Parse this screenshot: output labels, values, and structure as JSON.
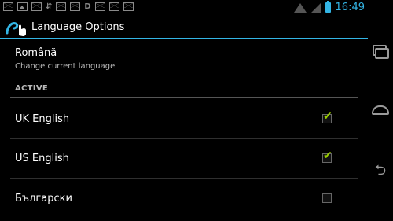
{
  "statusbar": {
    "time": "16:49",
    "notification_icons": [
      "mail-icon",
      "image-icon",
      "mail-icon",
      "sync-icon",
      "mail-icon",
      "mail-icon",
      "d-icon",
      "mail-icon",
      "mail-icon",
      "mail-icon"
    ],
    "d_glyph": "D"
  },
  "actionbar": {
    "title": "Language Options"
  },
  "current_language": {
    "value": "Română",
    "subtitle": "Change current language"
  },
  "section": {
    "title": "ACTIVE"
  },
  "languages": [
    {
      "label": "UK English",
      "checked": true
    },
    {
      "label": "US English",
      "checked": true
    },
    {
      "label": "Български",
      "checked": false
    }
  ],
  "colors": {
    "accent": "#33b5e5",
    "check": "#99cc00"
  }
}
